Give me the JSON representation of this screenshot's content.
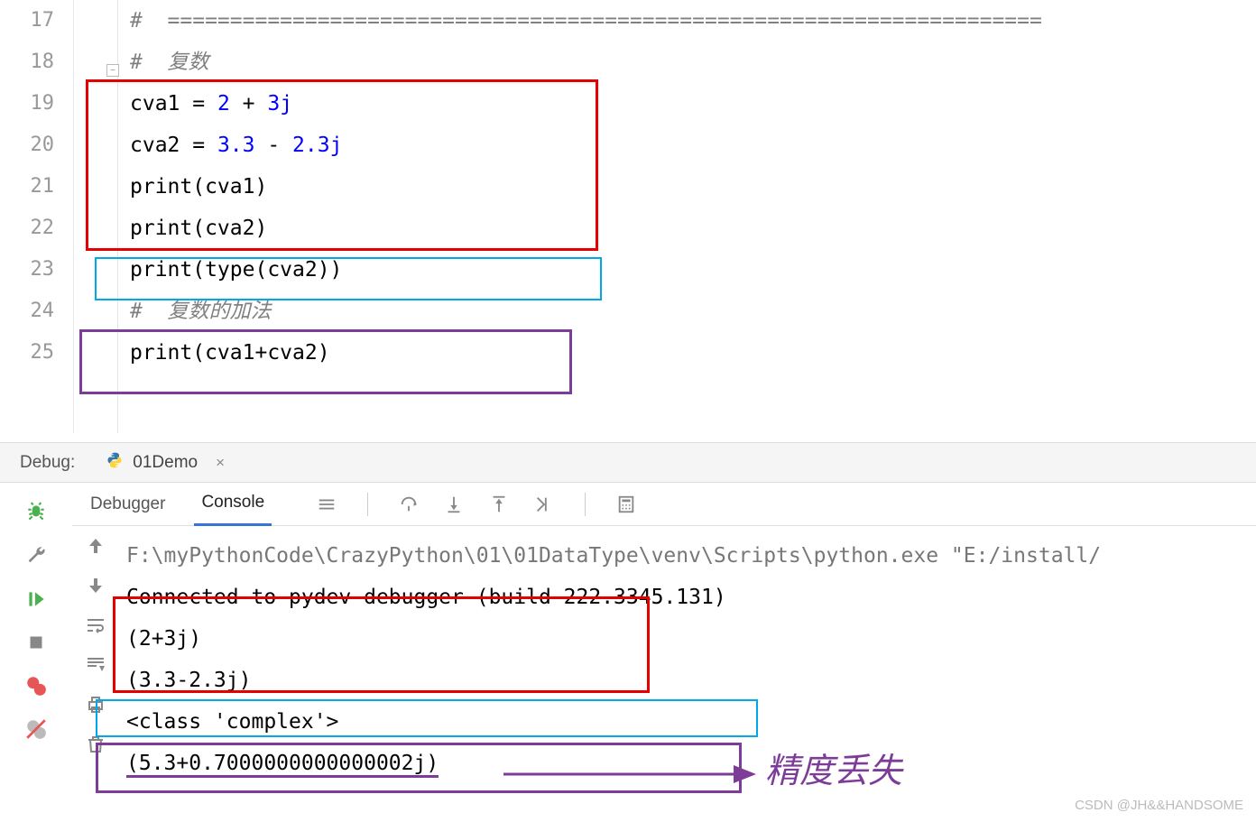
{
  "editor": {
    "line_numbers": [
      "17",
      "18",
      "19",
      "20",
      "21",
      "22",
      "23",
      "24",
      "25"
    ],
    "line17": "#  ======================================================================",
    "line18_prefix": "#  ",
    "line18_text": "复数",
    "line19_var": "cva1 ",
    "line19_eq": "= ",
    "line19_n1": "2",
    "line19_op": " + ",
    "line19_n2": "3j",
    "line20_var": "cva2 ",
    "line20_eq": "= ",
    "line20_n1": "3.3",
    "line20_op": " - ",
    "line20_n2": "2.3j",
    "line21": "print(cva1)",
    "line22": "print(cva2)",
    "line23": "print(type(cva2))",
    "line24_prefix": "#  ",
    "line24_text": "复数的加法",
    "line25": "print(cva1+cva2)"
  },
  "debug": {
    "label": "Debug:",
    "tab_file": "01Demo",
    "tab_debugger": "Debugger",
    "tab_console": "Console"
  },
  "console": {
    "line1": "F:\\myPythonCode\\CrazyPython\\01\\01DataType\\venv\\Scripts\\python.exe \"E:/install/",
    "line2": "Connected to pydev debugger (build 222.3345.131)",
    "line3": "(2+3j)",
    "line4": "(3.3-2.3j)",
    "line5": "<class 'complex'>",
    "line6": "(5.3+0.7000000000000002j)"
  },
  "annotation": "精度丢失",
  "watermark": "CSDN @JH&&HANDSOME"
}
